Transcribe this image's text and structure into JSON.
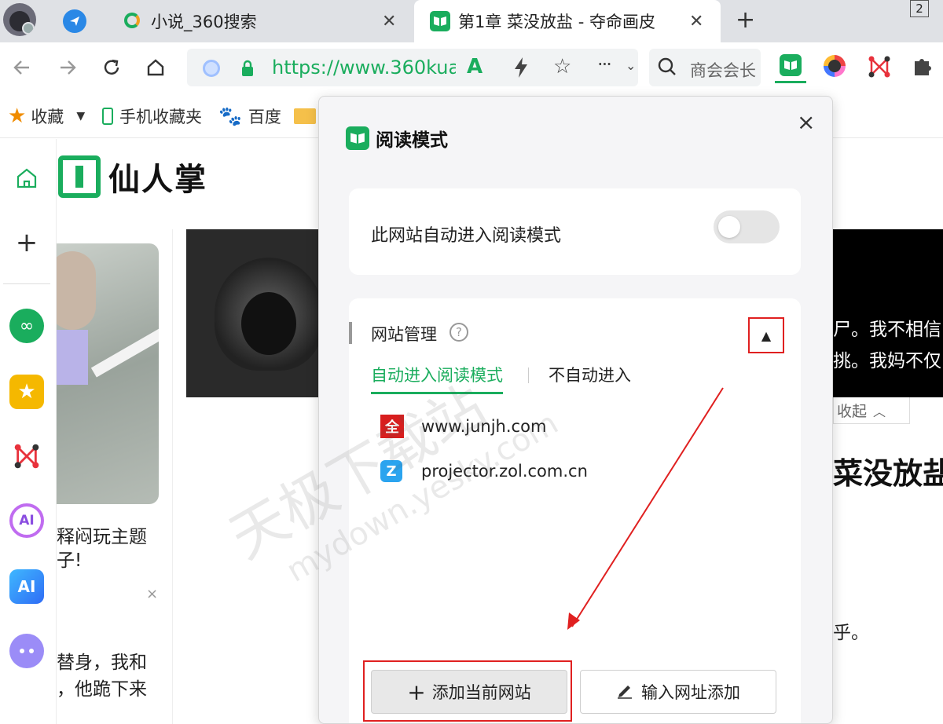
{
  "tabs": [
    {
      "title": "小说_360搜索"
    },
    {
      "title": "第1章 菜没放盐 - 夺命画皮"
    }
  ],
  "tab_counter": "2",
  "address": {
    "url": "https://www.360kua",
    "search_placeholder": "商会会长"
  },
  "bookmarks": [
    {
      "label": "收藏"
    },
    {
      "label": "手机收藏夹"
    },
    {
      "label": "百度"
    }
  ],
  "page": {
    "brand": "仙人掌",
    "ad_text_1": "释闷玩主题",
    "ad_text_2": "子!",
    "ad_close": "×",
    "story_line_1": "替身，我和",
    "story_line_2": "，他跪下来",
    "right_text_1": "尸。我不相信",
    "right_text_2": "挑。我妈不仅",
    "collapse_label": "收起",
    "chapter_heading": "菜没放盐",
    "right_text_3": "乎。"
  },
  "popup": {
    "title": "阅读模式",
    "close": "×",
    "auto_label": "此网站自动进入阅读模式",
    "toggle_on": false,
    "manage_title": "网站管理",
    "help": "?",
    "tabs": [
      {
        "label": "自动进入阅读模式"
      },
      {
        "label": "不自动进入"
      }
    ],
    "sites": [
      {
        "domain": "www.junjh.com"
      },
      {
        "domain": "projector.zol.com.cn"
      }
    ],
    "add_current": "添加当前网站",
    "add_by_url": "输入网址添加"
  },
  "watermark": {
    "line1": "天极下载站",
    "line2": "mydown.yesky.com"
  },
  "colors": {
    "accent_green": "#1aad5d",
    "highlight_red": "#e02020",
    "tabbar": "#dfe1e5"
  }
}
